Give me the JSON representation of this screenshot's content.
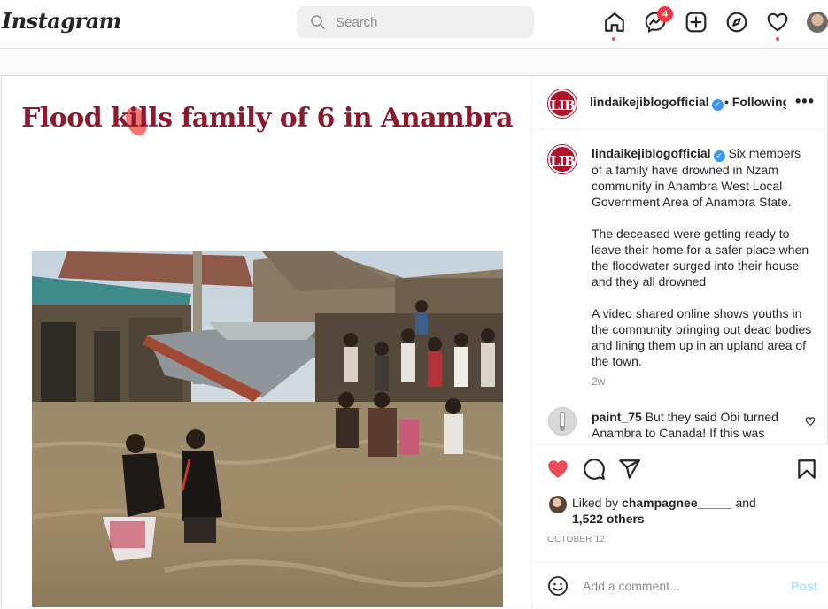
{
  "topbar": {
    "logo": "Instagram",
    "search_placeholder": "Search",
    "messages_badge": "4"
  },
  "post": {
    "headline": "Flood kills family of 6 in Anambra",
    "author": "lindaikejiblogofficial",
    "avatar_text": "LIB",
    "follow_status": "Following",
    "caption_paragraphs": [
      "Six members of a family have drowned in Nzam community in Anambra West Local Government Area of Anambra State.",
      "The deceased were getting ready to leave their home for a safer place when the floodwater surged into their house and they all drowned",
      "A video shared online shows youths in the community bringing out dead bodies and lining them up in an upland area of the town."
    ],
    "caption_time": "2w",
    "comment": {
      "user": "paint_75",
      "text": "But they said Obi turned Anambra to Canada! If this was"
    },
    "likes": {
      "prefix": "Liked by",
      "user": "champagnee_____",
      "and": "and",
      "others": "1,522 others"
    },
    "date": "OCTOBER 12",
    "add_comment_placeholder": "Add a comment...",
    "post_label": "Post"
  },
  "colors": {
    "headline": "#8b1a2e",
    "like_red": "#ed4956",
    "badge": "#ff3040",
    "verified": "#3897f0",
    "post_button": "#b2dffc"
  }
}
